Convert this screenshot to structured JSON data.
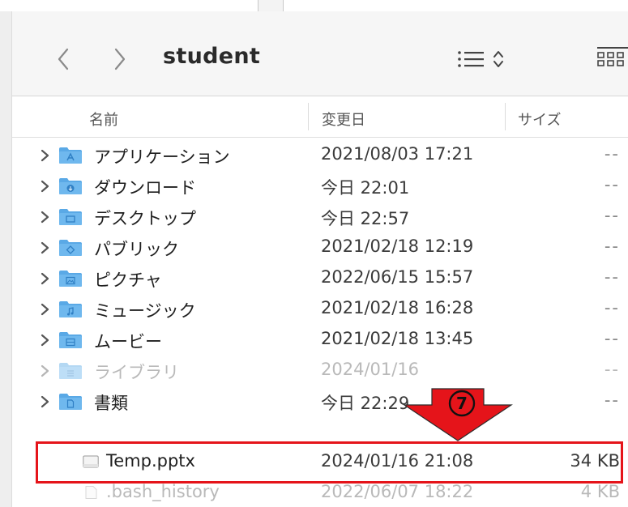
{
  "window": {
    "folder_title": "student"
  },
  "toolbar": {
    "back_icon": "chevron-left-icon",
    "forward_icon": "chevron-right-icon",
    "list_view_icon": "list-view-icon",
    "grid_view_icon": "grid-view-icon"
  },
  "columns": {
    "name": "名前",
    "date": "変更日",
    "size": "サイズ"
  },
  "rows": [
    {
      "name": "アプリケーション",
      "date": "2021/08/03 17:21",
      "size": "--",
      "icon": "applications-folder-icon"
    },
    {
      "name": "ダウンロード",
      "date": "今日 22:01",
      "size": "--",
      "icon": "downloads-folder-icon"
    },
    {
      "name": "デスクトップ",
      "date": "今日 22:57",
      "size": "--",
      "icon": "desktop-folder-icon"
    },
    {
      "name": "パブリック",
      "date": "2021/02/18 12:19",
      "size": "--",
      "icon": "public-folder-icon"
    },
    {
      "name": "ピクチャ",
      "date": "2022/06/15 15:57",
      "size": "--",
      "icon": "pictures-folder-icon"
    },
    {
      "name": "ミュージック",
      "date": "2021/02/18 16:28",
      "size": "--",
      "icon": "music-folder-icon"
    },
    {
      "name": "ムービー",
      "date": "2021/02/18 13:45",
      "size": "--",
      "icon": "movies-folder-icon"
    },
    {
      "name": "ライブラリ",
      "date": "2024/01/16",
      "size": "--",
      "icon": "library-folder-icon"
    },
    {
      "name": "書類",
      "date": "今日 22:29",
      "size": "--",
      "icon": "documents-folder-icon"
    },
    {
      "name": "Temp.pptx",
      "date": "2024/01/16 21:08",
      "size": "34 KB",
      "icon": "file-icon"
    },
    {
      "name": ".bash_history",
      "date": "2022/06/07 18:22",
      "size": "4 KB",
      "icon": "file-icon"
    }
  ],
  "annotation": {
    "step_number": "⑦",
    "highlight_color": "#e5141a"
  },
  "colors": {
    "folder_blue": "#5aa9e6",
    "folder_blue_dark": "#3d8fd1",
    "annotation_red": "#e5141a"
  }
}
